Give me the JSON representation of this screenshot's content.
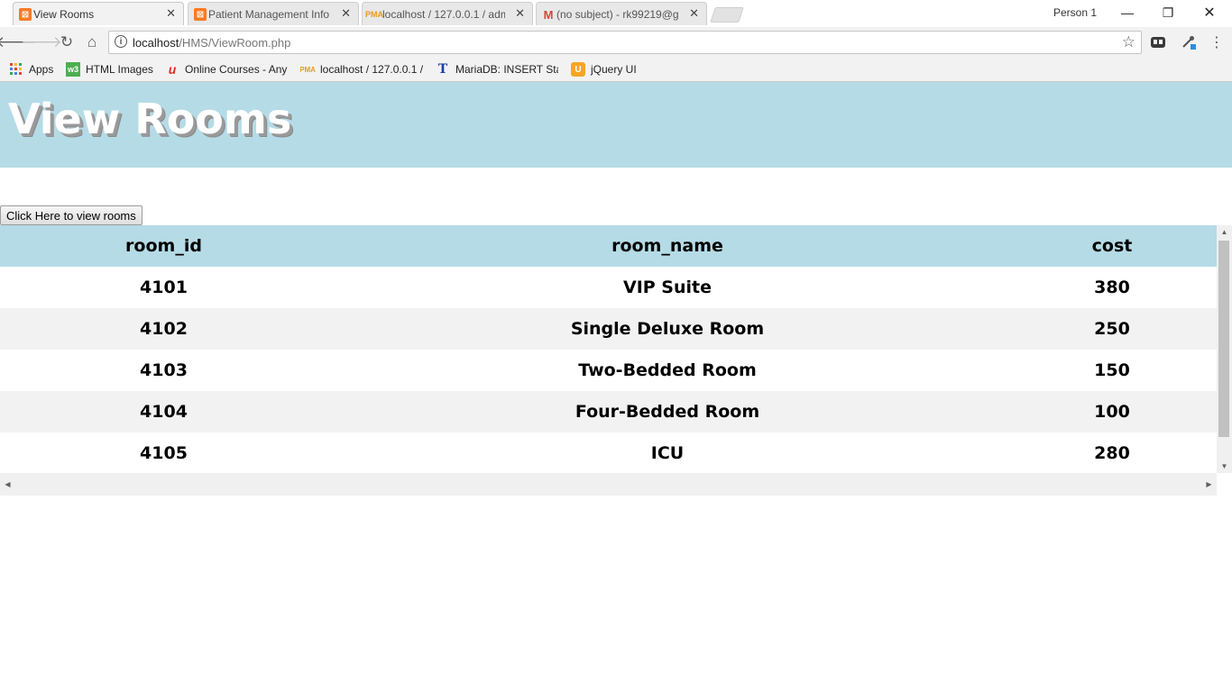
{
  "browser": {
    "tabs": [
      {
        "title": "View Rooms",
        "favicon": "xampp-icon",
        "active": true
      },
      {
        "title": "Patient Management Info",
        "favicon": "xampp-icon",
        "active": false
      },
      {
        "title": "localhost / 127.0.0.1 / adm",
        "favicon": "phpmyadmin-icon",
        "active": false
      },
      {
        "title": "(no subject) - rk99219@g",
        "favicon": "gmail-icon",
        "active": false
      }
    ],
    "profile": "Person 1",
    "address": {
      "host": "localhost",
      "path": "/HMS/ViewRoom.php"
    },
    "bookmarks": [
      {
        "label": "Apps",
        "icon": "apps-grid-icon"
      },
      {
        "label": "HTML Images",
        "icon": "w3schools-icon"
      },
      {
        "label": "Online Courses - Any",
        "icon": "udemy-icon"
      },
      {
        "label": "localhost / 127.0.0.1 /",
        "icon": "phpmyadmin-icon"
      },
      {
        "label": "MariaDB: INSERT State",
        "icon": "techonthenet-icon"
      },
      {
        "label": "jQuery UI",
        "icon": "jquery-ui-icon"
      }
    ]
  },
  "page": {
    "heading": "View Rooms",
    "button_label": "Click Here to view rooms",
    "table": {
      "columns": [
        "room_id",
        "room_name",
        "cost"
      ],
      "rows": [
        [
          "4101",
          "VIP Suite",
          "380"
        ],
        [
          "4102",
          "Single Deluxe Room",
          "250"
        ],
        [
          "4103",
          "Two-Bedded Room",
          "150"
        ],
        [
          "4104",
          "Four-Bedded Room",
          "100"
        ],
        [
          "4105",
          "ICU",
          "280"
        ]
      ]
    }
  },
  "colors": {
    "banner": "#b5dbe6",
    "row_alt": "#f2f2f2"
  }
}
